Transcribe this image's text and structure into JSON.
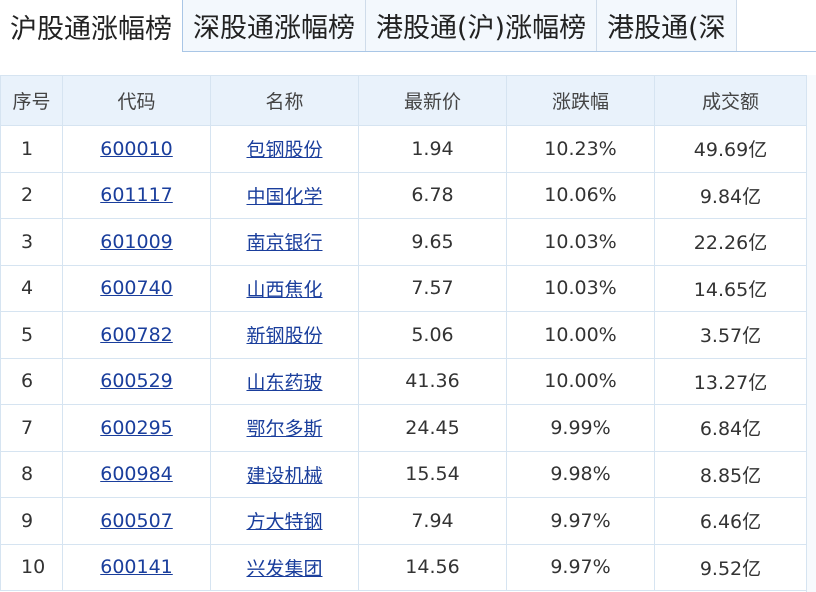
{
  "tabs": [
    {
      "label": "沪股通涨幅榜",
      "active": true
    },
    {
      "label": "深股通涨幅榜",
      "active": false
    },
    {
      "label": "港股通(沪)涨幅榜",
      "active": false
    },
    {
      "label": "港股通(深",
      "active": false
    }
  ],
  "table": {
    "headers": [
      "序号",
      "代码",
      "名称",
      "最新价",
      "涨跌幅",
      "成交额"
    ],
    "rows": [
      {
        "no": "1",
        "code": "600010",
        "name": "包钢股份",
        "price": "1.94",
        "change": "10.23%",
        "turnover": "49.69亿"
      },
      {
        "no": "2",
        "code": "601117",
        "name": "中国化学",
        "price": "6.78",
        "change": "10.06%",
        "turnover": "9.84亿"
      },
      {
        "no": "3",
        "code": "601009",
        "name": "南京银行",
        "price": "9.65",
        "change": "10.03%",
        "turnover": "22.26亿"
      },
      {
        "no": "4",
        "code": "600740",
        "name": "山西焦化",
        "price": "7.57",
        "change": "10.03%",
        "turnover": "14.65亿"
      },
      {
        "no": "5",
        "code": "600782",
        "name": "新钢股份",
        "price": "5.06",
        "change": "10.00%",
        "turnover": "3.57亿"
      },
      {
        "no": "6",
        "code": "600529",
        "name": "山东药玻",
        "price": "41.36",
        "change": "10.00%",
        "turnover": "13.27亿"
      },
      {
        "no": "7",
        "code": "600295",
        "name": "鄂尔多斯",
        "price": "24.45",
        "change": "9.99%",
        "turnover": "6.84亿"
      },
      {
        "no": "8",
        "code": "600984",
        "name": "建设机械",
        "price": "15.54",
        "change": "9.98%",
        "turnover": "8.85亿"
      },
      {
        "no": "9",
        "code": "600507",
        "name": "方大特钢",
        "price": "7.94",
        "change": "9.97%",
        "turnover": "6.46亿"
      },
      {
        "no": "10",
        "code": "600141",
        "name": "兴发集团",
        "price": "14.56",
        "change": "9.97%",
        "turnover": "9.52亿"
      }
    ]
  },
  "colors": {
    "up": "#e8261d",
    "link": "#1a3e9c",
    "header_bg": "#e9f2fb",
    "border": "#d6e4f1"
  }
}
